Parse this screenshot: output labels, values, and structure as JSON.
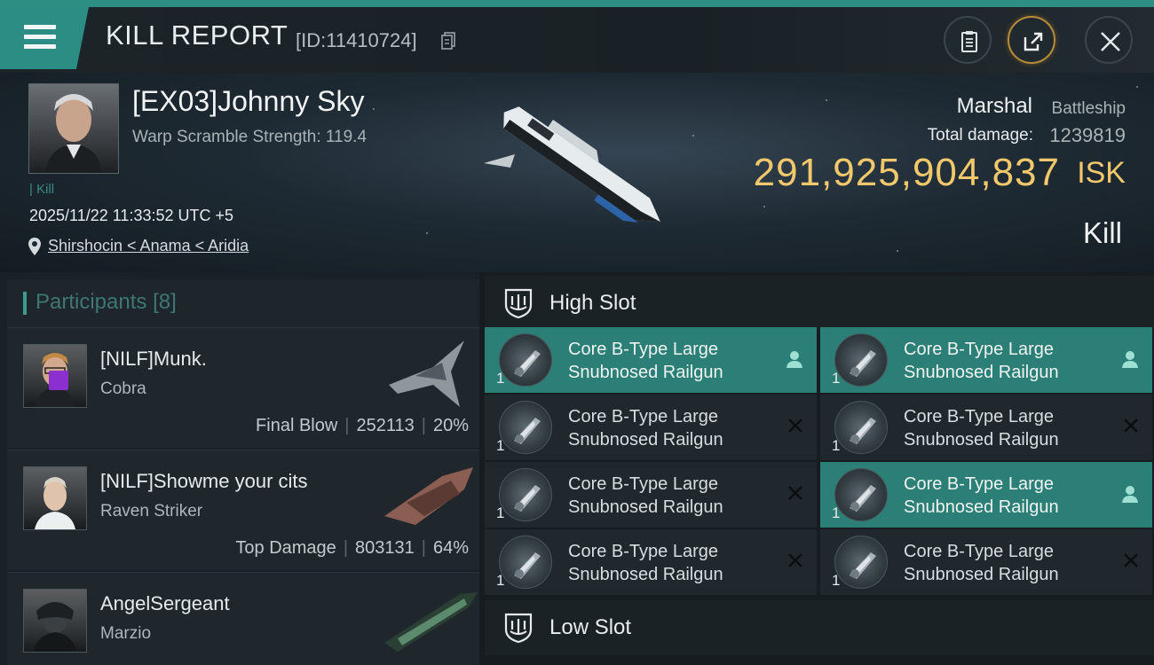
{
  "header": {
    "title": "KILL REPORT",
    "report_id": "[ID:11410724]"
  },
  "victim": {
    "name": "[EX03]Johnny Sky",
    "warp_scramble": "Warp Scramble Strength: 119.4",
    "kill_tag": "| Kill",
    "timestamp": "2025/11/22 11:33:52 UTC +5",
    "location": "Shirshocin < Anama < Aridia"
  },
  "ship": {
    "name": "Marshal",
    "class": "Battleship",
    "damage_label": "Total damage:",
    "damage_value": "1239819",
    "isk_value": "291,925,904,837",
    "isk_unit": "ISK",
    "result": "Kill"
  },
  "participants": {
    "title": "Participants",
    "count": "[8]",
    "rows": [
      {
        "name": "[NILF]Munk.",
        "ship": "Cobra",
        "role": "Final Blow",
        "damage": "252113",
        "percent": "20%"
      },
      {
        "name": "[NILF]Showme your cits",
        "ship": "Raven Striker",
        "role": "Top Damage",
        "damage": "803131",
        "percent": "64%"
      },
      {
        "name": "AngelSergeant",
        "ship": "Marzio",
        "role": "",
        "damage": "",
        "percent": ""
      }
    ]
  },
  "slots": {
    "high_title": "High Slot",
    "low_title": "Low Slot",
    "modules": [
      {
        "name": "Core B-Type Large Snubnosed Railgun",
        "qty": "1",
        "status": "dropped"
      },
      {
        "name": "Core B-Type Large Snubnosed Railgun",
        "qty": "1",
        "status": "dropped"
      },
      {
        "name": "Core B-Type Large Snubnosed Railgun",
        "qty": "1",
        "status": "destroyed"
      },
      {
        "name": "Core B-Type Large Snubnosed Railgun",
        "qty": "1",
        "status": "destroyed"
      },
      {
        "name": "Core B-Type Large Snubnosed Railgun",
        "qty": "1",
        "status": "destroyed"
      },
      {
        "name": "Core B-Type Large Snubnosed Railgun",
        "qty": "1",
        "status": "dropped"
      },
      {
        "name": "Core B-Type Large Snubnosed Railgun",
        "qty": "1",
        "status": "destroyed"
      },
      {
        "name": "Core B-Type Large Snubnosed Railgun",
        "qty": "1",
        "status": "destroyed"
      }
    ]
  },
  "colors": {
    "accent": "#2b8d83",
    "isk": "#f1c86b",
    "dropped_row": "#2c7f76",
    "purple_badge": "#8c2fd1"
  },
  "icons": [
    "menu-icon",
    "copy-icon",
    "clipboard-icon",
    "share-icon",
    "close-icon",
    "location-pin-icon",
    "shield-icon",
    "railgun-icon",
    "person-icon",
    "x-icon"
  ]
}
